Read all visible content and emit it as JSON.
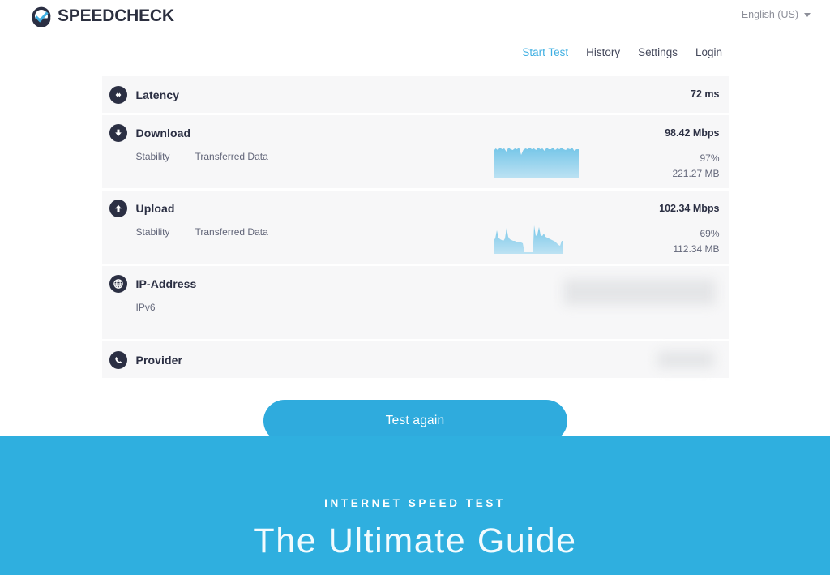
{
  "header": {
    "brand_name": "SPEEDCHECK",
    "brand_icon": "speedcheck-check-circle-icon",
    "language": {
      "label": "English (US)",
      "caret_icon": "chevron-down-icon"
    }
  },
  "nav": {
    "items": [
      {
        "label": "Start Test",
        "active": true
      },
      {
        "label": "History",
        "active": false
      },
      {
        "label": "Settings",
        "active": false
      },
      {
        "label": "Login",
        "active": false
      }
    ]
  },
  "results": {
    "latency": {
      "icon": "left-right-arrow-icon",
      "title": "Latency",
      "value": "72 ms"
    },
    "download": {
      "icon": "arrow-down-icon",
      "title": "Download",
      "value": "98.42 Mbps",
      "stability_label": "Stability",
      "transferred_label": "Transferred Data",
      "stability_value": "97%",
      "transferred_value": "221.27 MB"
    },
    "upload": {
      "icon": "arrow-up-icon",
      "title": "Upload",
      "value": "102.34 Mbps",
      "stability_label": "Stability",
      "transferred_label": "Transferred Data",
      "stability_value": "69%",
      "transferred_value": "112.34 MB"
    },
    "ip_address": {
      "icon": "globe-icon",
      "title": "IP-Address",
      "protocol_label": "IPv6",
      "value": ""
    },
    "provider": {
      "icon": "phone-handset-icon",
      "title": "Provider",
      "value": ""
    }
  },
  "cta": {
    "label": "Test again"
  },
  "hero": {
    "kicker": "INTERNET SPEED TEST",
    "title": "The Ultimate Guide"
  },
  "colors": {
    "accent": "#2fabdd",
    "hero_bg": "#2fafdf",
    "icon_badge": "#2b2f43",
    "row_bg": "#f7f7f8",
    "text_dark": "#2b2f43",
    "text_muted": "#63677a"
  },
  "chart_data": [
    {
      "type": "area",
      "name": "download-throughput-sparkline",
      "title": "Download throughput over test duration",
      "xlabel": "",
      "ylabel": "Mbps",
      "grid": false,
      "legend": "none",
      "ylim": [
        0,
        110
      ],
      "x": [
        0,
        1,
        2,
        3,
        4,
        5,
        6,
        7,
        8,
        9,
        10,
        11,
        12,
        13,
        14,
        15,
        16,
        17,
        18,
        19,
        20,
        21,
        22,
        23,
        24,
        25,
        26,
        27,
        28,
        29,
        30,
        31,
        32,
        33,
        34,
        35,
        36,
        37,
        38,
        39
      ],
      "values": [
        95,
        99,
        96,
        100,
        97,
        99,
        94,
        100,
        98,
        96,
        99,
        97,
        100,
        82,
        96,
        99,
        97,
        100,
        98,
        99,
        96,
        100,
        97,
        99,
        95,
        100,
        98,
        97,
        100,
        96,
        99,
        97,
        100,
        98,
        96,
        99,
        97,
        100,
        95,
        98
      ]
    },
    {
      "type": "area",
      "name": "upload-throughput-sparkline",
      "title": "Upload throughput over test duration",
      "xlabel": "",
      "ylabel": "Mbps",
      "grid": false,
      "legend": "none",
      "ylim": [
        0,
        110
      ],
      "x": [
        0,
        1,
        2,
        3,
        4,
        5,
        6,
        7,
        8,
        9,
        10,
        11,
        12,
        13,
        14,
        15,
        16,
        17,
        18,
        19,
        20,
        21,
        22,
        23,
        24,
        25,
        26,
        27,
        28,
        29,
        30,
        31,
        32,
        33,
        34,
        35,
        36,
        37,
        38,
        39
      ],
      "values": [
        55,
        58,
        82,
        60,
        56,
        54,
        52,
        58,
        88,
        62,
        57,
        55,
        53,
        52,
        50,
        49,
        48,
        47,
        46,
        22,
        46,
        100,
        70,
        68,
        92,
        66,
        64,
        70,
        62,
        60,
        58,
        56,
        54,
        52,
        50,
        48,
        44,
        40,
        38,
        52
      ]
    }
  ]
}
